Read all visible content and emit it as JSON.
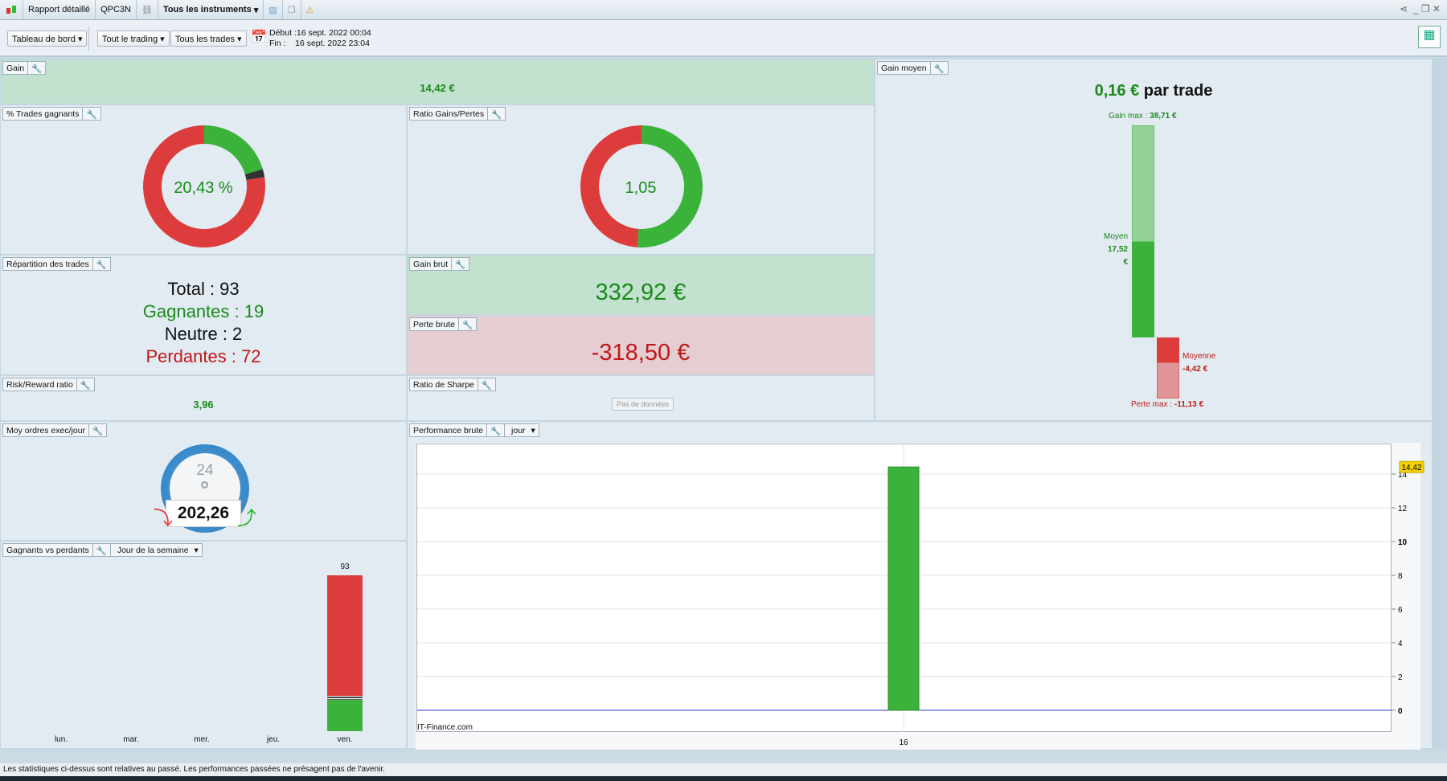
{
  "titlebar": {
    "report": "Rapport détaillé",
    "account": "QPC3N",
    "instruments": "Tous les instruments"
  },
  "toolbar": {
    "view": "Tableau de bord",
    "trading": "Tout le trading",
    "trades": "Tous les trades",
    "start_label": "Début :",
    "start": "16 sept. 2022 00:04",
    "end_label": "Fin :",
    "end": "16 sept. 2022 23:04"
  },
  "gain": {
    "label": "Gain",
    "value": "14,42 €"
  },
  "win_pct": {
    "label": "% Trades gagnants",
    "value": "20,43 %",
    "win": 19,
    "neutral": 2,
    "loss": 72
  },
  "ratio": {
    "label": "Ratio Gains/Pertes",
    "value": "1,05",
    "gain": 332.92,
    "loss": 318.5
  },
  "repartition": {
    "label": "Répartition des trades",
    "total": "Total : 93",
    "win": "Gagnantes : 19",
    "neutral": "Neutre : 2",
    "loss": "Perdantes : 72"
  },
  "gain_brut": {
    "label": "Gain brut",
    "value": "332,92 €"
  },
  "perte_brute": {
    "label": "Perte brute",
    "value": "-318,50 €"
  },
  "risk": {
    "label": "Risk/Reward ratio",
    "value": "3,96"
  },
  "sharpe": {
    "label": "Ratio de Sharpe",
    "value": "Pas de données"
  },
  "moy_ordres": {
    "label": "Moy ordres exec/jour",
    "value": "202,26",
    "dial": "24"
  },
  "gain_moyen": {
    "label": "Gain moyen",
    "value": "0,16 €",
    "suffix": " par trade",
    "gain_max_label": "Gain max : ",
    "gain_max": "38,71 €",
    "moyen_label": "Moyen",
    "moyen": "17,52 €",
    "moyenne_label": "Moyenne",
    "moyenne": "-4,42 €",
    "perte_max_label": "Perte max : ",
    "perte_max": "-11,13 €"
  },
  "gvp": {
    "label": "Gagnants vs perdants",
    "mode": "Jour de la semaine"
  },
  "perf": {
    "label": "Performance brute",
    "mode": "jour",
    "watermark": "IT-Finance.com"
  },
  "footer": "Les statistiques ci-dessus sont relatives au passé. Les performances passées ne présagent pas de l'avenir.",
  "colors": {
    "green": "#3bb33b",
    "red": "#dd3c3c",
    "lightgreen": "#93d296",
    "lightred": "#e09497"
  },
  "chart_data": [
    {
      "type": "bar",
      "title": "Gagnants vs perdants",
      "categories": [
        "lun.",
        "mar.",
        "mer.",
        "jeu.",
        "ven."
      ],
      "series": [
        {
          "name": "gagnants",
          "values": [
            0,
            0,
            0,
            0,
            19
          ]
        },
        {
          "name": "neutres",
          "values": [
            0,
            0,
            0,
            0,
            2
          ]
        },
        {
          "name": "perdants",
          "values": [
            0,
            0,
            0,
            0,
            72
          ]
        }
      ],
      "totals": [
        "",
        "",
        "",
        "",
        "93"
      ]
    },
    {
      "type": "bar",
      "title": "Performance brute",
      "categories": [
        "16"
      ],
      "values": [
        14.42
      ],
      "value_label": "14,42",
      "ylim": [
        -1,
        15.5
      ],
      "yticks": [
        "0",
        "2",
        "4",
        "6",
        "8",
        "10",
        "12",
        "14"
      ]
    }
  ]
}
